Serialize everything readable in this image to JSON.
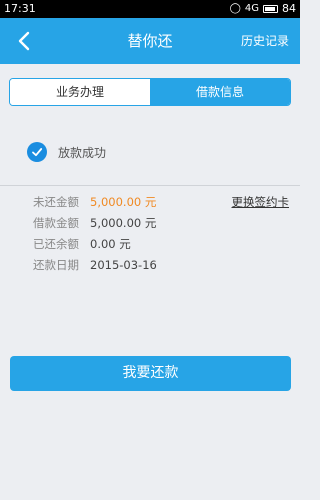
{
  "status_bar": {
    "time": "17:31",
    "icons": [
      "alarm-icon",
      "signal-icon",
      "battery-icon"
    ],
    "signal_label": "4G",
    "battery_level": "84"
  },
  "nav": {
    "back_icon": "chevron-left-icon",
    "title": "替你还",
    "history_label": "历史记录"
  },
  "tabs": [
    {
      "label": "业务办理",
      "active": false
    },
    {
      "label": "借款信息",
      "active": true
    }
  ],
  "status": {
    "icon": "check-circle-icon",
    "text": "放款成功"
  },
  "info": {
    "rows": [
      {
        "label": "未还金额",
        "value": "5,000.00 元",
        "highlight": true
      },
      {
        "label": "借款金额",
        "value": "5,000.00 元",
        "highlight": false
      },
      {
        "label": "已还余额",
        "value": "0.00 元",
        "highlight": false
      },
      {
        "label": "还款日期",
        "value": "2015-03-16",
        "highlight": false
      }
    ],
    "change_card_label": "更换签约卡"
  },
  "action_button_label": "我要还款",
  "colors": {
    "accent": "#27a4e6",
    "check": "#1a8de0",
    "highlight": "#f08a24",
    "background": "#eceef2"
  }
}
